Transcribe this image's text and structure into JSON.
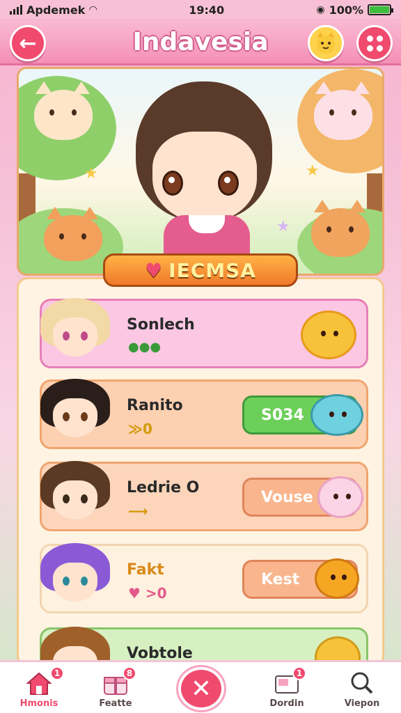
{
  "status_bar": {
    "carrier": "Apdemek",
    "time": "19:40",
    "battery": "100%",
    "battery_level": 1.0
  },
  "header": {
    "title": "Indavesia",
    "back_icon": "arrow-left-icon",
    "cat_icon": "cat-face-icon",
    "menu_icon": "dots-grid-icon"
  },
  "hero": {
    "banner_text": "IECMSA"
  },
  "players": [
    {
      "name": "Sonlech",
      "sub": "",
      "button_label": "",
      "highlight": "pink"
    },
    {
      "name": "Ranito",
      "sub": "≫0",
      "button_label": "S034",
      "highlight": "orange"
    },
    {
      "name": "Ledrie O",
      "sub": "",
      "button_label": "Vouse",
      "highlight": "peach"
    },
    {
      "name": "Fakt",
      "sub": "♥ >0",
      "button_label": "Kest",
      "highlight": "cream"
    },
    {
      "name": "Vobtole",
      "sub": "",
      "button_label": "",
      "highlight": "green"
    }
  ],
  "bottom_nav": {
    "items": [
      {
        "label": "Hmonis",
        "icon": "home-icon",
        "badge": "1"
      },
      {
        "label": "Featte",
        "icon": "gift-icon",
        "badge": "8"
      },
      {
        "label": "Dordin",
        "icon": "card-icon",
        "badge": "1"
      },
      {
        "label": "Viepon",
        "icon": "search-icon",
        "badge": ""
      }
    ],
    "center_icon": "close-icon"
  },
  "colors": {
    "accent": "#f04a6e",
    "header": "#f58fb6",
    "panel": "#fff4e3",
    "green_button": "#6ccf5a",
    "peach_button": "#f9b68e"
  }
}
